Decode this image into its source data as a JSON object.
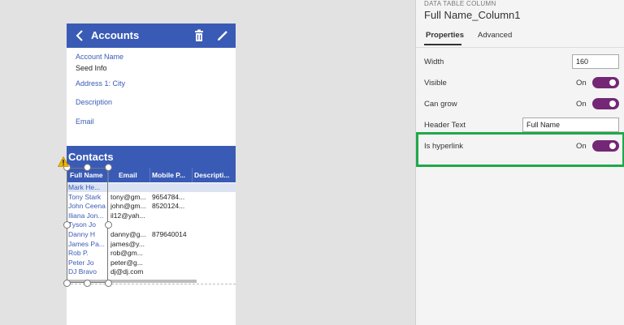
{
  "app": {
    "header_title": "Accounts",
    "fields": [
      {
        "label": "Account Name",
        "value": "Seed Info"
      },
      {
        "label": "Address 1: City",
        "value": ""
      },
      {
        "label": "Description",
        "value": ""
      },
      {
        "label": "Email",
        "value": ""
      }
    ],
    "contacts_title": "Contacts",
    "table": {
      "headers": [
        "Full Name",
        "Email",
        "Mobile P...",
        "Descripti..."
      ],
      "rows": [
        {
          "name": "Mark He...",
          "email": "",
          "mobile": ""
        },
        {
          "name": "Tony Stark",
          "email": "tony@gm...",
          "mobile": "9654784..."
        },
        {
          "name": "John Ceena",
          "email": "john@gm...",
          "mobile": "8520124..."
        },
        {
          "name": "Iliana Jon...",
          "email": "il12@yah...",
          "mobile": ""
        },
        {
          "name": "Tyson Jo",
          "email": "",
          "mobile": ""
        },
        {
          "name": "Danny H",
          "email": "danny@g...",
          "mobile": "879640014"
        },
        {
          "name": "James Pa...",
          "email": "james@y...",
          "mobile": ""
        },
        {
          "name": "Rob P.",
          "email": "rob@gm...",
          "mobile": ""
        },
        {
          "name": "Peter Jo",
          "email": "peter@g...",
          "mobile": ""
        },
        {
          "name": "DJ Bravo",
          "email": "dj@dj.com",
          "mobile": ""
        }
      ]
    }
  },
  "panel": {
    "caption": "DATA TABLE COLUMN",
    "title": "Full Name_Column1",
    "tabs": [
      "Properties",
      "Advanced"
    ],
    "properties": {
      "width_label": "Width",
      "width_value": "160",
      "visible_label": "Visible",
      "visible_state": "On",
      "can_grow_label": "Can grow",
      "can_grow_state": "On",
      "header_text_label": "Header Text",
      "header_text_value": "Full Name",
      "hyperlink_label": "Is hyperlink",
      "hyperlink_state": "On"
    }
  },
  "colors": {
    "header_blue": "#3a5bb5",
    "toggle_purple": "#742774",
    "highlight_green": "#1fa84a"
  }
}
